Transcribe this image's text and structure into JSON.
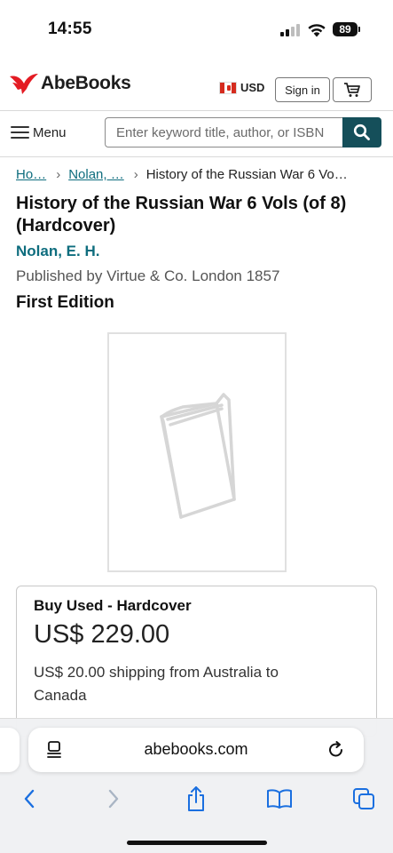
{
  "status_bar": {
    "time": "14:55",
    "battery": "89",
    "signal_bars_active": 2,
    "signal_bars_total": 4
  },
  "header": {
    "logo_text": "AbeBooks",
    "logo_icon": "abebooks-bird-logo",
    "currency": "USD",
    "currency_flag": "canada-flag",
    "signin_label": "Sign in",
    "cart_icon": "shopping-cart-icon"
  },
  "search": {
    "menu_label": "Menu",
    "placeholder": "Enter keyword title, author, or ISBN",
    "value": "",
    "search_icon": "search-icon"
  },
  "breadcrumb": {
    "items": [
      "Ho…",
      "Nolan, …",
      "History of the Russian War 6 Vo…"
    ]
  },
  "product": {
    "title": "History of the Russian War 6 Vols (of 8) (Hardcover)",
    "author": "Nolan, E. H.",
    "published": "Published by Virtue & Co. London 1857",
    "edition": "First Edition",
    "cover_icon": "book-placeholder-icon"
  },
  "buy_box": {
    "heading": "Buy Used - Hardcover",
    "price": "US$ 229.00",
    "shipping": "US$ 20.00 shipping from Australia to Canada"
  },
  "browser": {
    "url": "abebooks.com",
    "icons": [
      "page-menu-icon",
      "reload-icon",
      "back-icon",
      "forward-icon",
      "share-icon",
      "bookmarks-icon",
      "tabs-icon"
    ]
  },
  "colors": {
    "accent_teal": "#0e6d7e",
    "search_button": "#154f5a",
    "logo_red": "#e41b23"
  }
}
